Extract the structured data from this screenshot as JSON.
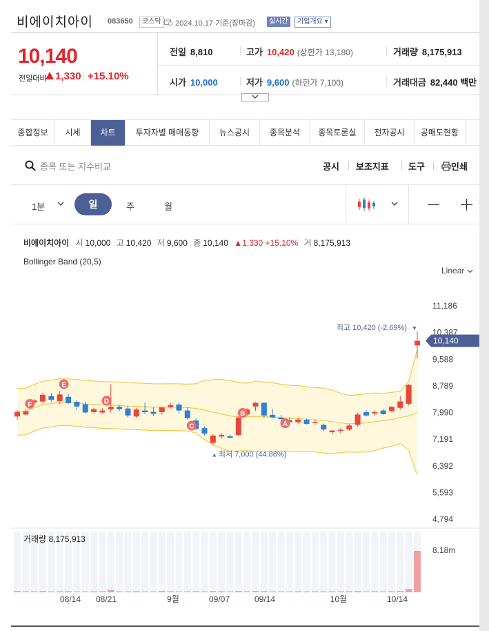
{
  "header": {
    "name": "비에이치아이",
    "code": "083650",
    "market": "코스닥",
    "date": "2024.10.17 기준(장마감)",
    "realtime": "실시간",
    "corp_overview": "기업개요"
  },
  "price": {
    "current": "10,140",
    "change_label": "전일대비",
    "change_value": "1,330",
    "change_pct": "+15.10%",
    "prev_label": "전일",
    "prev": "8,810",
    "high_label": "고가",
    "high": "10,420",
    "upper_limit": "(상한가 13,180)",
    "volume_label": "거래량",
    "volume": "8,175,913",
    "open_label": "시가",
    "open": "10,000",
    "low_label": "저가",
    "low": "9,600",
    "lower_limit": "(하한가 7,100)",
    "amount_label": "거래대금",
    "amount": "82,440 백만"
  },
  "tabs": [
    "종합정보",
    "시세",
    "차트",
    "투자자별 매매동향",
    "뉴스공시",
    "종목분석",
    "종목토론실",
    "전자공시",
    "공매도현황"
  ],
  "active_tab": 2,
  "toolbar": {
    "search_placeholder": "종목 또는 지수비교",
    "notice": "공시",
    "indicators": "보조지표",
    "tools": "도구",
    "print": "인쇄"
  },
  "periods": {
    "minute": "1분",
    "day": "일",
    "week": "주",
    "month": "월"
  },
  "info": {
    "name": "비에이치아이",
    "open_lbl": "시",
    "open": "10,000",
    "high_lbl": "고",
    "high": "10,420",
    "low_lbl": "저",
    "low": "9,600",
    "close_lbl": "종",
    "close": "10,140",
    "change": "1,330 +15.10%",
    "vol_lbl": "거",
    "vol": "8,175,913"
  },
  "indicator_label": "Bollinger Band (20,5)",
  "scale_mode": "Linear",
  "colors": {
    "up": "#e8473e",
    "down": "#2f7fd6",
    "band_fill": "#fff8dc",
    "band_line": "#f2c94c",
    "accent": "#4c5f96"
  },
  "chart_data": {
    "type": "candlestick",
    "y_ticks": [
      "11,186",
      "10,387",
      "9,588",
      "8,789",
      "7,990",
      "7,191",
      "6,392",
      "5,593",
      "4,794"
    ],
    "x_ticks": [
      "08/14",
      "08/21",
      "9월",
      "09/07",
      "09/14",
      "10월",
      "10/14"
    ],
    "ylim": [
      4794,
      11186
    ],
    "max_annotation": "최고 10,420 (-2.69%)",
    "min_annotation": "최저 7,000 (44.86%)",
    "current_price_tag": "10,140",
    "markers": [
      "F",
      "E",
      "D",
      "C",
      "B",
      "A"
    ],
    "candles": [
      {
        "o": 7870,
        "h": 8060,
        "l": 7780,
        "c": 8010
      },
      {
        "o": 7930,
        "h": 8100,
        "l": 7900,
        "c": 8030
      },
      {
        "o": 8290,
        "h": 8400,
        "l": 8230,
        "c": 8350
      },
      {
        "o": 8320,
        "h": 8580,
        "l": 8260,
        "c": 8520
      },
      {
        "o": 8480,
        "h": 8580,
        "l": 8310,
        "c": 8370
      },
      {
        "o": 8330,
        "h": 8640,
        "l": 8240,
        "c": 8530
      },
      {
        "o": 8460,
        "h": 8560,
        "l": 8250,
        "c": 8270
      },
      {
        "o": 8310,
        "h": 8360,
        "l": 8070,
        "c": 8170
      },
      {
        "o": 8240,
        "h": 8300,
        "l": 7960,
        "c": 7990
      },
      {
        "o": 8000,
        "h": 8120,
        "l": 7960,
        "c": 8090
      },
      {
        "o": 7990,
        "h": 8120,
        "l": 7950,
        "c": 8050
      },
      {
        "o": 8080,
        "h": 8840,
        "l": 7990,
        "c": 8160
      },
      {
        "o": 8160,
        "h": 8210,
        "l": 8030,
        "c": 8090
      },
      {
        "o": 8110,
        "h": 8190,
        "l": 7840,
        "c": 7900
      },
      {
        "o": 7870,
        "h": 8130,
        "l": 7820,
        "c": 8080
      },
      {
        "o": 8050,
        "h": 8290,
        "l": 7940,
        "c": 8000
      },
      {
        "o": 8010,
        "h": 8140,
        "l": 7880,
        "c": 7950
      },
      {
        "o": 8000,
        "h": 8160,
        "l": 7920,
        "c": 8140
      },
      {
        "o": 8150,
        "h": 8280,
        "l": 8090,
        "c": 8210
      },
      {
        "o": 8230,
        "h": 8280,
        "l": 7960,
        "c": 8050
      },
      {
        "o": 8050,
        "h": 8150,
        "l": 7780,
        "c": 7820
      },
      {
        "o": 7750,
        "h": 7810,
        "l": 7470,
        "c": 7500
      },
      {
        "o": 7520,
        "h": 7570,
        "l": 7300,
        "c": 7360
      },
      {
        "o": 7080,
        "h": 7340,
        "l": 7000,
        "c": 7300
      },
      {
        "o": 7270,
        "h": 7370,
        "l": 7210,
        "c": 7320
      },
      {
        "o": 7280,
        "h": 7320,
        "l": 7210,
        "c": 7230
      },
      {
        "o": 7310,
        "h": 7880,
        "l": 7300,
        "c": 7840
      },
      {
        "o": 7930,
        "h": 8120,
        "l": 7890,
        "c": 8080
      },
      {
        "o": 8170,
        "h": 8300,
        "l": 8040,
        "c": 8280
      },
      {
        "o": 8280,
        "h": 8300,
        "l": 7830,
        "c": 7900
      },
      {
        "o": 7920,
        "h": 8100,
        "l": 7820,
        "c": 7840
      },
      {
        "o": 7840,
        "h": 7920,
        "l": 7730,
        "c": 7790
      },
      {
        "o": 7760,
        "h": 7850,
        "l": 7650,
        "c": 7700
      },
      {
        "o": 7700,
        "h": 7830,
        "l": 7640,
        "c": 7780
      },
      {
        "o": 7770,
        "h": 7800,
        "l": 7630,
        "c": 7650
      },
      {
        "o": 7670,
        "h": 7780,
        "l": 7610,
        "c": 7700
      },
      {
        "o": 7620,
        "h": 7660,
        "l": 7420,
        "c": 7480
      },
      {
        "o": 7400,
        "h": 7470,
        "l": 7330,
        "c": 7450
      },
      {
        "o": 7460,
        "h": 7530,
        "l": 7360,
        "c": 7470
      },
      {
        "o": 7480,
        "h": 7650,
        "l": 7440,
        "c": 7600
      },
      {
        "o": 7620,
        "h": 7990,
        "l": 7560,
        "c": 7930
      },
      {
        "o": 8000,
        "h": 8060,
        "l": 7870,
        "c": 7900
      },
      {
        "o": 7960,
        "h": 8050,
        "l": 7900,
        "c": 8000
      },
      {
        "o": 8050,
        "h": 8100,
        "l": 7920,
        "c": 7940
      },
      {
        "o": 8030,
        "h": 8180,
        "l": 7990,
        "c": 8160
      },
      {
        "o": 8130,
        "h": 8480,
        "l": 8080,
        "c": 8320
      },
      {
        "o": 8250,
        "h": 8850,
        "l": 8200,
        "c": 8810
      },
      {
        "o": 10000,
        "h": 10420,
        "l": 9600,
        "c": 10140
      }
    ],
    "volume_label": "거래량",
    "volume_value": "8,175,913",
    "volume_tick": "8.18m",
    "volumes": [
      0.03,
      0.02,
      0.02,
      0.03,
      0.02,
      0.02,
      0.03,
      0.02,
      0.02,
      0.02,
      0.02,
      0.06,
      0.02,
      0.02,
      0.02,
      0.02,
      0.02,
      0.03,
      0.02,
      0.02,
      0.02,
      0.03,
      0.02,
      0.03,
      0.02,
      0.02,
      0.03,
      0.02,
      0.03,
      0.03,
      0.02,
      0.02,
      0.02,
      0.02,
      0.02,
      0.02,
      0.02,
      0.02,
      0.02,
      0.02,
      0.03,
      0.02,
      0.02,
      0.02,
      0.02,
      0.03,
      0.08,
      1.0
    ]
  }
}
